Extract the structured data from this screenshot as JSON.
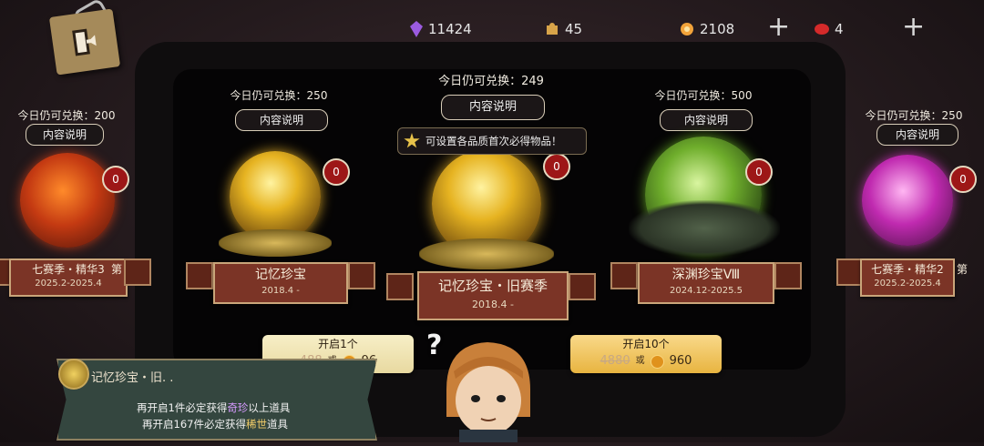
{
  "currencies": [
    {
      "icon": "purple-crystal-icon",
      "value": "11424",
      "color": "#9b5be0"
    },
    {
      "icon": "puzzle-piece-icon",
      "value": "45",
      "color": "#d8a449"
    },
    {
      "icon": "candy-coin-icon",
      "value": "2108",
      "color": "#f2a33a"
    },
    {
      "icon": "red-gem-icon",
      "value": "4",
      "color": "#d42a2a"
    }
  ],
  "chests": {
    "far_left": {
      "quota": "今日仍可兑换：200",
      "info": "内容说明",
      "badge": "0",
      "name": "七赛季・精华3",
      "extra": "第",
      "dates": "2025.2-2025.4"
    },
    "left": {
      "quota": "今日仍可兑换：250",
      "info": "内容说明",
      "badge": "0",
      "name": "记忆珍宝",
      "dates": "2018.4 -"
    },
    "center": {
      "quota": "今日仍可兑换：249",
      "info": "内容说明",
      "badge": "0",
      "name": "记忆珍宝・旧赛季",
      "dates": "2018.4 -"
    },
    "right": {
      "quota": "今日仍可兑换：500",
      "info": "内容说明",
      "badge": "0",
      "name": "深渊珍宝Ⅷ",
      "dates": "2024.12-2025.5"
    },
    "far_right": {
      "quota": "今日仍可兑换：250",
      "info": "内容说明",
      "badge": "0",
      "name": "七赛季・精华2",
      "extra": "第",
      "dates": "2025.2-2025.4"
    }
  },
  "tooltip": "可设置各品质首次必得物品！",
  "open_one": {
    "label": "开启1个",
    "original_cost": "488",
    "or": "或",
    "cost": "96"
  },
  "open_ten": {
    "label": "开启10个",
    "original_cost": "4880",
    "or": "或",
    "cost": "960"
  },
  "note": {
    "title": "记忆珍宝・旧. .",
    "line1_prefix": "再开启1件必定获得",
    "line1_hl": "奇珍",
    "line1_suffix": "以上道具",
    "line2_prefix": "再开启167件必定获得",
    "line2_hl": "稀世",
    "line2_suffix": "道具"
  },
  "question_mark": "?"
}
